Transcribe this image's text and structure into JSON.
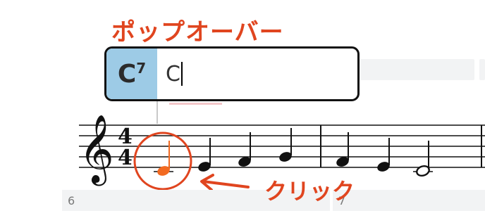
{
  "annotations": {
    "title": "ポップオーバー",
    "click_label": "クリック"
  },
  "popover": {
    "chord_root": "C",
    "chord_extension": "7",
    "input_value": "C"
  },
  "measures": {
    "first_number": "6",
    "second_number": "7"
  },
  "colors": {
    "annotation": "#e0451f",
    "chord_preview_bg": "#9dcbe6",
    "selected_note": "#f26a21"
  }
}
